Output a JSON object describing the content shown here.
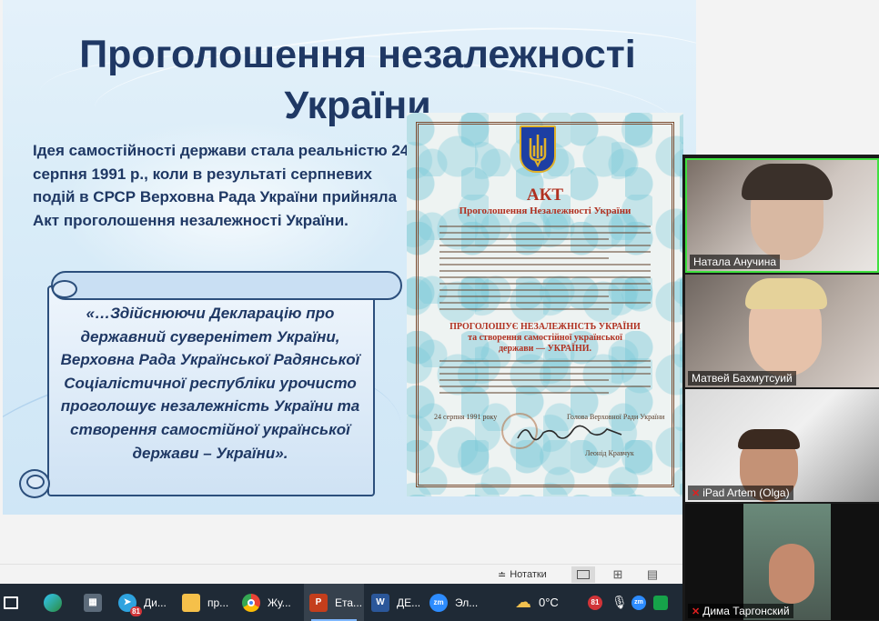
{
  "slide": {
    "title_line1": "Проголошення незалежності",
    "title_line2": "України",
    "idea_text": "Ідея самостійності держави   стала реальністю 24 серпня 1991 р., коли в результаті серпневих подій в СРСР Верховна Рада України прийняла  Акт проголошення незалежності України.",
    "quote": "«…Здійснюючи Декларацію про державний суверенітет України, Верховна Рада Української Радянської   Соціалістичної республіки  урочисто  проголошує незалежність України та створення самостійної української держави – України».",
    "document": {
      "heading": "АКТ",
      "subheading": "Проголошення Незалежності України",
      "proclaim_1": "ПРОГОЛОШУЄ НЕЗАЛЕЖНІСТЬ УКРАЇНИ",
      "proclaim_2": "та створення самостійної української",
      "proclaim_3": "держави — УКРАЇНИ.",
      "date": "24 серпня 1991 року",
      "signature_title": "Голова Верховної Ради України",
      "signer": "Леонід Кравчук"
    }
  },
  "statusbar": {
    "notes_label": "Нотатки"
  },
  "taskbar": {
    "items": [
      {
        "icon": "task-view-icon",
        "label": ""
      },
      {
        "icon": "edge-icon",
        "label": ""
      },
      {
        "icon": "calculator-icon",
        "label": ""
      },
      {
        "icon": "telegram-icon",
        "label": "Ди...",
        "badge": "81"
      },
      {
        "icon": "folder-icon",
        "label": "пр..."
      },
      {
        "icon": "chrome-icon",
        "label": "Жу..."
      },
      {
        "icon": "powerpoint-icon",
        "label": "Ета..."
      },
      {
        "icon": "word-icon",
        "label": "ДЕ..."
      },
      {
        "icon": "zoom-icon",
        "label": "Эл..."
      }
    ],
    "weather": "0°C",
    "tray_badge": "81"
  },
  "participants": [
    {
      "name": "Натала Анучина",
      "muted": false,
      "speaking": true
    },
    {
      "name": "Матвей Бахмутсуий",
      "muted": false,
      "speaking": false
    },
    {
      "name": "iPad Artem (Olga)",
      "muted": true,
      "speaking": false
    },
    {
      "name": "Дима Таргонский",
      "muted": true,
      "speaking": false
    }
  ],
  "colors": {
    "title": "#1f3864",
    "document_red": "#b03020",
    "taskbar": "#1f2a36",
    "speaker_border": "#3fe03f",
    "muted_mic": "#e02020"
  }
}
